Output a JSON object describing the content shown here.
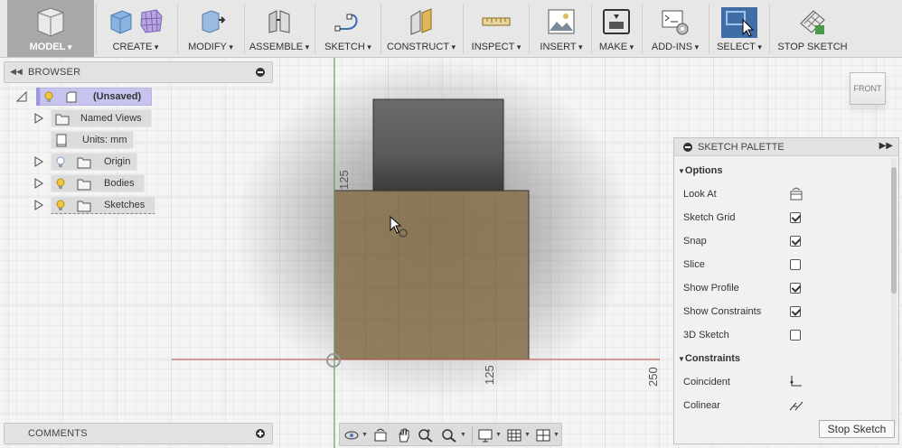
{
  "toolbar": {
    "model": "MODEL",
    "create": "CREATE",
    "modify": "MODIFY",
    "assemble": "ASSEMBLE",
    "sketch": "SKETCH",
    "construct": "CONSTRUCT",
    "inspect": "INSPECT",
    "insert": "INSERT",
    "make": "MAKE",
    "addins": "ADD-INS",
    "select": "SELECT",
    "stop_sketch": "STOP SKETCH"
  },
  "browser": {
    "title": "BROWSER",
    "items": [
      {
        "label": "(Unsaved)"
      },
      {
        "label": "Named Views"
      },
      {
        "label": "Units: mm"
      },
      {
        "label": "Origin"
      },
      {
        "label": "Bodies"
      },
      {
        "label": "Sketches"
      }
    ]
  },
  "comments": {
    "title": "COMMENTS"
  },
  "viewcube": {
    "label": "FRONT"
  },
  "canvas": {
    "dim_125_vertical": "125",
    "dim_125_horizontal": "125",
    "dim_250_horizontal": "250",
    "colors": {
      "body": "#8a7552",
      "box": "#5e5e5e",
      "x_axis": "#b04a3a",
      "y_axis": "#5a9a5a"
    }
  },
  "palette": {
    "title": "SKETCH PALETTE",
    "sections": {
      "options": "Options",
      "constraints": "Constraints"
    },
    "options": [
      {
        "label": "Look At",
        "type": "icon"
      },
      {
        "label": "Sketch Grid",
        "checked": true
      },
      {
        "label": "Snap",
        "checked": true
      },
      {
        "label": "Slice",
        "checked": false
      },
      {
        "label": "Show Profile",
        "checked": true
      },
      {
        "label": "Show Constraints",
        "checked": true
      },
      {
        "label": "3D Sketch",
        "checked": false
      }
    ],
    "constraints": [
      {
        "label": "Coincident"
      },
      {
        "label": "Colinear"
      }
    ],
    "stop_button": "Stop Sketch"
  }
}
